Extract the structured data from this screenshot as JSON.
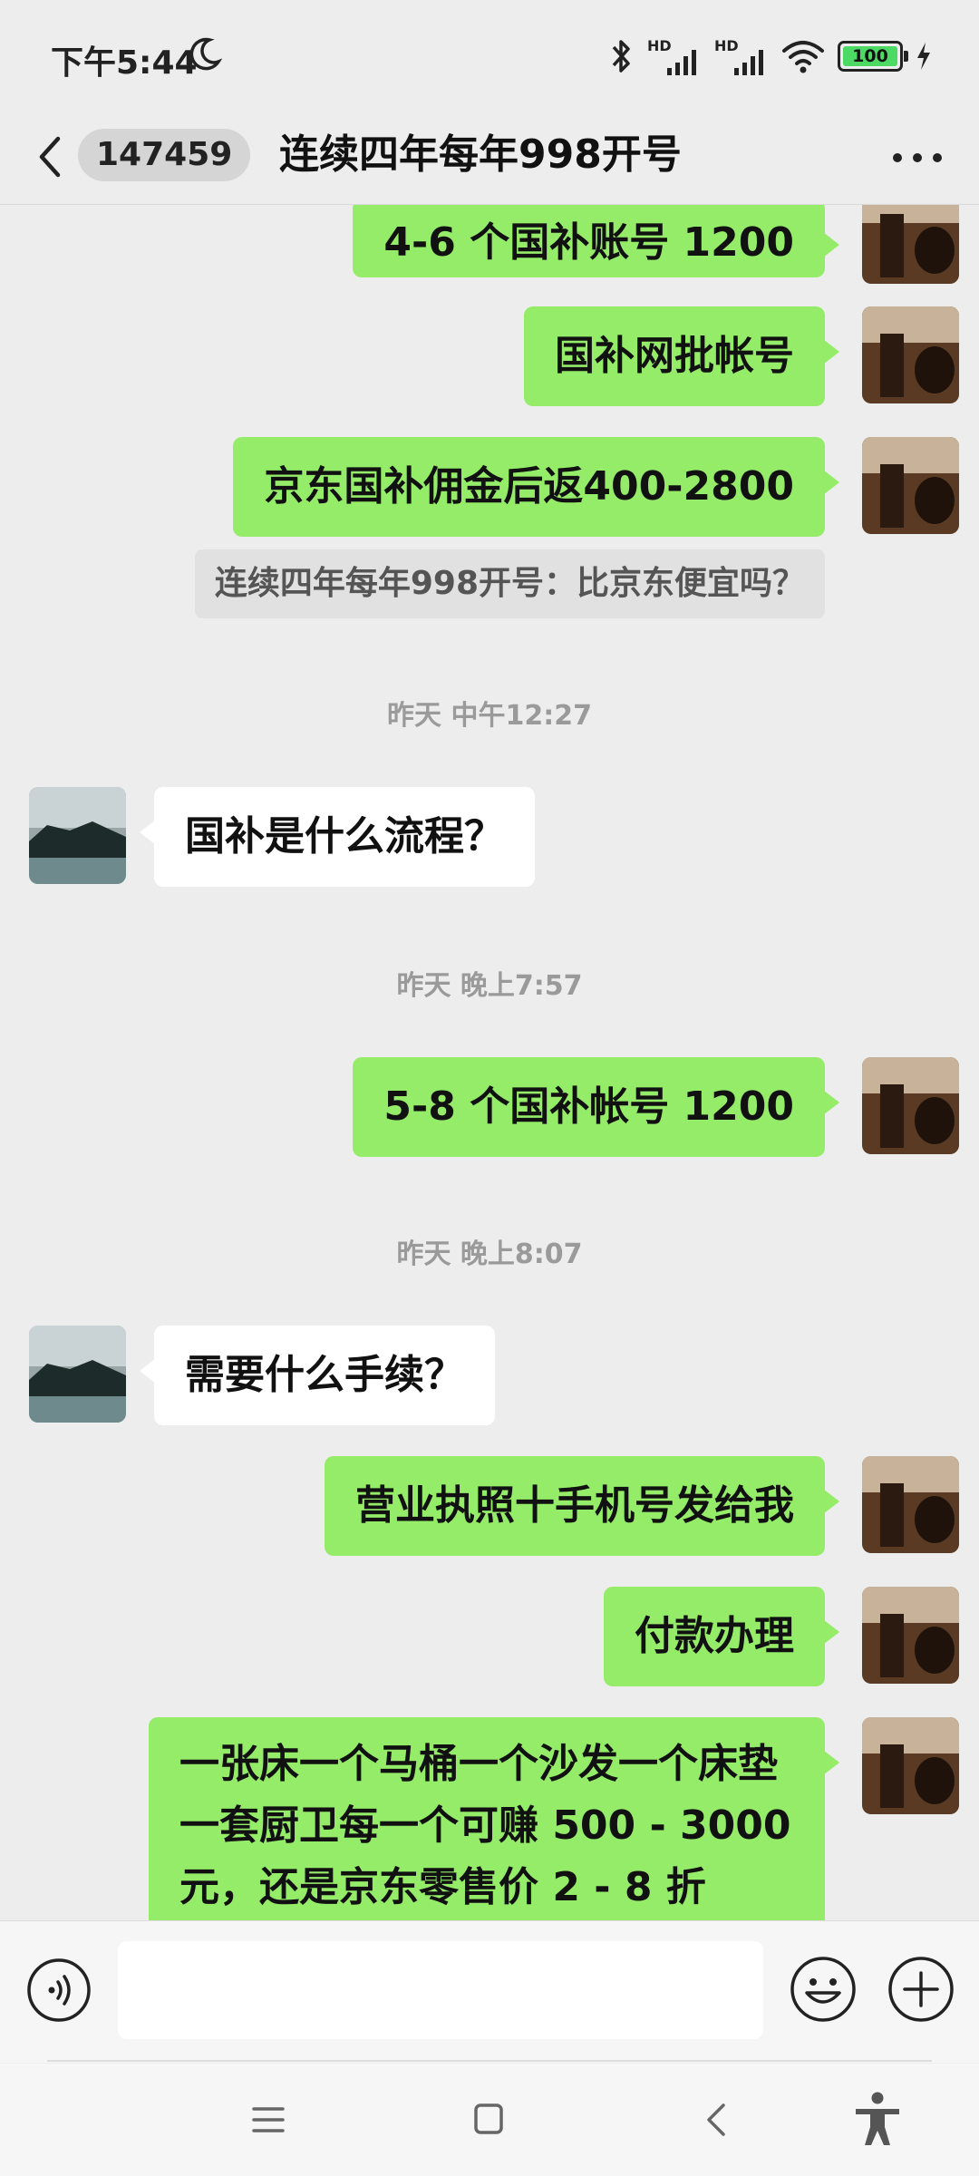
{
  "status_bar": {
    "time": "下午5:44",
    "hd1": "HD",
    "hd2": "HD",
    "battery": "100",
    "icons": [
      "moon-icon",
      "bluetooth-icon",
      "signal-icon",
      "wifi-icon",
      "battery-icon",
      "charging-icon"
    ]
  },
  "header": {
    "back_icon": "chevron-left-icon",
    "unread_badge": "147459",
    "title": "连续四年每年998开号",
    "more_icon": "more-icon"
  },
  "messages": [
    {
      "type": "outgoing",
      "text": "4-6 个国补账号 1200"
    },
    {
      "type": "outgoing",
      "text": "国补网批帐号"
    },
    {
      "type": "outgoing",
      "text": "京东国补佣金后返400-2800"
    },
    {
      "type": "quote",
      "text": "连续四年每年998开号：比京东便宜吗？"
    },
    {
      "type": "timestamp",
      "text": "昨天 中午12:27"
    },
    {
      "type": "incoming",
      "text": "国补是什么流程？"
    },
    {
      "type": "timestamp",
      "text": "昨天 晚上7:57"
    },
    {
      "type": "outgoing",
      "text": "5-8 个国补帐号 1200"
    },
    {
      "type": "timestamp",
      "text": "昨天 晚上8:07"
    },
    {
      "type": "incoming",
      "text": "需要什么手续？"
    },
    {
      "type": "outgoing",
      "text": "营业执照十手机号发给我"
    },
    {
      "type": "outgoing",
      "text": "付款办理"
    },
    {
      "type": "outgoing",
      "lines": [
        "一张床一个马桶一个沙发一个床垫",
        "一套厨卫每一个可赚 500 - 3000",
        "元，还是京东零售价 2 - 8 折"
      ]
    }
  ],
  "input_bar": {
    "voice_icon": "voice-icon",
    "text_value": "",
    "emoji_icon": "emoji-icon",
    "plus_icon": "plus-icon"
  },
  "nav_bar": {
    "icons": [
      "menu-icon",
      "home-icon",
      "back-icon",
      "accessibility-icon"
    ]
  },
  "colors": {
    "background": "#ededed",
    "outgoing_bubble": "#95ec69",
    "incoming_bubble": "#ffffff",
    "quote_bubble": "#e1e1e1",
    "battery_fill": "#4cd964"
  }
}
